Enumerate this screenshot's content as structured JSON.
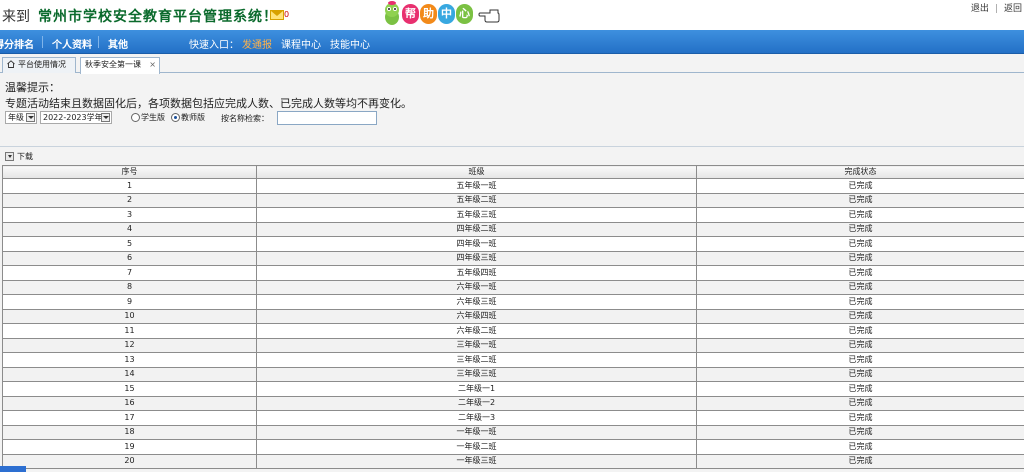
{
  "header": {
    "welcome_prefix": "来到",
    "system_name": "常州市学校安全教育平台管理系统！",
    "mail_count": "0",
    "help_chars": [
      "帮",
      "助",
      "中",
      "心"
    ],
    "top_links": [
      "退出",
      "返回"
    ]
  },
  "nav": {
    "items": [
      "得分排名",
      "个人资料",
      "其他"
    ],
    "quick_label": "快速入口：",
    "quick_hot": "发通报",
    "quick_links": [
      "课程中心",
      "技能中心"
    ]
  },
  "tabs": [
    {
      "label": "平台使用情况",
      "active": false
    },
    {
      "label": "秋季安全第一课",
      "active": true
    }
  ],
  "tip": {
    "title": "温馨提示：",
    "text": "专题活动结束且数据固化后，各项数据包括应完成人数、已完成人数等均不再变化。"
  },
  "filters": {
    "grade_select": "年级",
    "year_select": "2022-2023学年",
    "radio_student": "学生版",
    "radio_teacher": "教师版",
    "search_label": "按名称检索：",
    "search_value": ""
  },
  "toolbar": {
    "download_label": "下载"
  },
  "table": {
    "columns": [
      "序号",
      "班级",
      "完成状态"
    ],
    "rows": [
      [
        "1",
        "五年级一班",
        "已完成"
      ],
      [
        "2",
        "五年级二班",
        "已完成"
      ],
      [
        "3",
        "五年级三班",
        "已完成"
      ],
      [
        "4",
        "四年级二班",
        "已完成"
      ],
      [
        "5",
        "四年级一班",
        "已完成"
      ],
      [
        "6",
        "四年级三班",
        "已完成"
      ],
      [
        "7",
        "五年级四班",
        "已完成"
      ],
      [
        "8",
        "六年级一班",
        "已完成"
      ],
      [
        "9",
        "六年级三班",
        "已完成"
      ],
      [
        "10",
        "六年级四班",
        "已完成"
      ],
      [
        "11",
        "六年级二班",
        "已完成"
      ],
      [
        "12",
        "三年级一班",
        "已完成"
      ],
      [
        "13",
        "三年级二班",
        "已完成"
      ],
      [
        "14",
        "三年级三班",
        "已完成"
      ],
      [
        "15",
        "二年级一1",
        "已完成"
      ],
      [
        "16",
        "二年级一2",
        "已完成"
      ],
      [
        "17",
        "二年级一3",
        "已完成"
      ],
      [
        "18",
        "一年级一班",
        "已完成"
      ],
      [
        "19",
        "一年级二班",
        "已完成"
      ],
      [
        "20",
        "一年级三班",
        "已完成"
      ]
    ]
  },
  "colors": {
    "nav_blue": "#2d7fd6",
    "system_name_green": "#0a6a2c",
    "hot_orange": "#ffb24a",
    "help_bubbles": [
      "#e8306f",
      "#f28a1a",
      "#38a8e0",
      "#7bc143"
    ]
  }
}
